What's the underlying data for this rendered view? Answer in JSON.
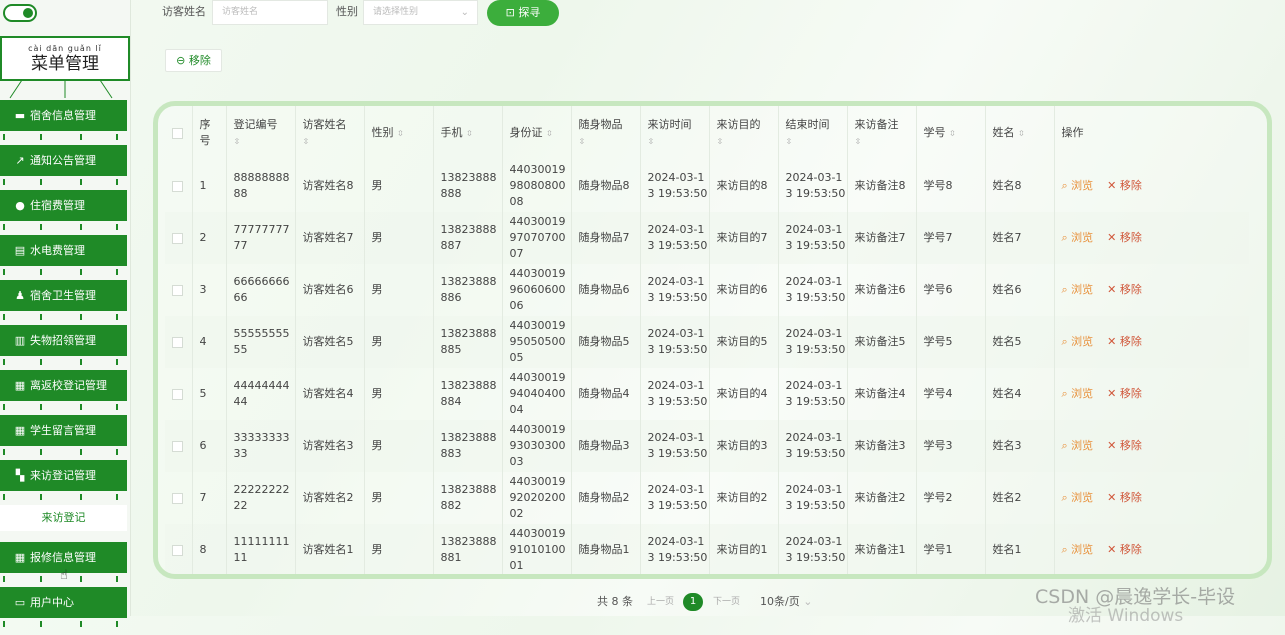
{
  "sidebar": {
    "title_pinyin": "cài dān guǎn lǐ",
    "title": "菜单管理",
    "items": [
      {
        "label": "宿舍信息管理",
        "icon": "monitor-icon"
      },
      {
        "label": "通知公告管理",
        "icon": "chart-icon"
      },
      {
        "label": "住宿费管理",
        "icon": "user-icon"
      },
      {
        "label": "水电费管理",
        "icon": "clipboard-icon"
      },
      {
        "label": "宿舍卫生管理",
        "icon": "person-icon"
      },
      {
        "label": "失物招领管理",
        "icon": "books-icon"
      },
      {
        "label": "离返校登记管理",
        "icon": "grid-icon"
      },
      {
        "label": "学生留言管理",
        "icon": "grid-icon"
      },
      {
        "label": "来访登记管理",
        "icon": "ticket-icon"
      },
      {
        "label": "报修信息管理",
        "icon": "grid-icon"
      },
      {
        "label": "用户中心",
        "icon": "card-icon"
      }
    ],
    "sub_item": "来访登记"
  },
  "search": {
    "name_label": "访客姓名",
    "name_placeholder": "访客姓名",
    "gender_label": "性别",
    "gender_placeholder": "请选择性别",
    "button": "探寻"
  },
  "toolbar": {
    "remove_label": "移除"
  },
  "table": {
    "headers": [
      "序号",
      "登记编号",
      "访客姓名",
      "性别",
      "手机",
      "身份证",
      "随身物品",
      "来访时间",
      "来访目的",
      "结束时间",
      "来访备注",
      "学号",
      "姓名",
      "操作"
    ],
    "rows": [
      {
        "idx": "1",
        "code": "88888888 88",
        "name": "访客姓名8",
        "gender": "男",
        "phone": "13823888 888",
        "idcard": "44030019 98080800 08",
        "items": "随身物品8",
        "visit_time": "2024-03-1 3 19:53:50",
        "purpose": "来访目的8",
        "end_time": "2024-03-1 3 19:53:50",
        "note": "来访备注8",
        "student_no": "学号8",
        "student_name": "姓名8"
      },
      {
        "idx": "2",
        "code": "77777777 77",
        "name": "访客姓名7",
        "gender": "男",
        "phone": "13823888 887",
        "idcard": "44030019 97070700 07",
        "items": "随身物品7",
        "visit_time": "2024-03-1 3 19:53:50",
        "purpose": "来访目的7",
        "end_time": "2024-03-1 3 19:53:50",
        "note": "来访备注7",
        "student_no": "学号7",
        "student_name": "姓名7"
      },
      {
        "idx": "3",
        "code": "66666666 66",
        "name": "访客姓名6",
        "gender": "男",
        "phone": "13823888 886",
        "idcard": "44030019 96060600 06",
        "items": "随身物品6",
        "visit_time": "2024-03-1 3 19:53:50",
        "purpose": "来访目的6",
        "end_time": "2024-03-1 3 19:53:50",
        "note": "来访备注6",
        "student_no": "学号6",
        "student_name": "姓名6"
      },
      {
        "idx": "4",
        "code": "55555555 55",
        "name": "访客姓名5",
        "gender": "男",
        "phone": "13823888 885",
        "idcard": "44030019 95050500 05",
        "items": "随身物品5",
        "visit_time": "2024-03-1 3 19:53:50",
        "purpose": "来访目的5",
        "end_time": "2024-03-1 3 19:53:50",
        "note": "来访备注5",
        "student_no": "学号5",
        "student_name": "姓名5"
      },
      {
        "idx": "5",
        "code": "44444444 44",
        "name": "访客姓名4",
        "gender": "男",
        "phone": "13823888 884",
        "idcard": "44030019 94040400 04",
        "items": "随身物品4",
        "visit_time": "2024-03-1 3 19:53:50",
        "purpose": "来访目的4",
        "end_time": "2024-03-1 3 19:53:50",
        "note": "来访备注4",
        "student_no": "学号4",
        "student_name": "姓名4"
      },
      {
        "idx": "6",
        "code": "33333333 33",
        "name": "访客姓名3",
        "gender": "男",
        "phone": "13823888 883",
        "idcard": "44030019 93030300 03",
        "items": "随身物品3",
        "visit_time": "2024-03-1 3 19:53:50",
        "purpose": "来访目的3",
        "end_time": "2024-03-1 3 19:53:50",
        "note": "来访备注3",
        "student_no": "学号3",
        "student_name": "姓名3"
      },
      {
        "idx": "7",
        "code": "22222222 22",
        "name": "访客姓名2",
        "gender": "男",
        "phone": "13823888 882",
        "idcard": "44030019 92020200 02",
        "items": "随身物品2",
        "visit_time": "2024-03-1 3 19:53:50",
        "purpose": "来访目的2",
        "end_time": "2024-03-1 3 19:53:50",
        "note": "来访备注2",
        "student_no": "学号2",
        "student_name": "姓名2"
      },
      {
        "idx": "8",
        "code": "11111111 11",
        "name": "访客姓名1",
        "gender": "男",
        "phone": "13823888 881",
        "idcard": "44030019 91010100 01",
        "items": "随身物品1",
        "visit_time": "2024-03-1 3 19:53:50",
        "purpose": "来访目的1",
        "end_time": "2024-03-1 3 19:53:50",
        "note": "来访备注1",
        "student_no": "学号1",
        "student_name": "姓名1"
      }
    ],
    "view_label": "浏览",
    "delete_label": "移除"
  },
  "pagination": {
    "total": "共 8 条",
    "prev": "上一页",
    "current": "1",
    "next": "下一页",
    "page_size": "10条/页"
  },
  "overlay": {
    "csdn": "CSDN @晨逸学长-毕设",
    "windows": "激活 Windows"
  },
  "colors": {
    "primary": "#1f8a27",
    "accent": "#3cae3c",
    "view": "#e8913c",
    "delete": "#d0573a"
  }
}
